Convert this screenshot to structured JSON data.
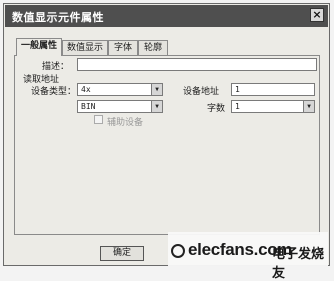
{
  "window": {
    "title": "数值显示元件属性",
    "close_glyph": "×"
  },
  "tabs": [
    {
      "label": "一般属性",
      "active": true
    },
    {
      "label": "数值显示",
      "active": false
    },
    {
      "label": "字体",
      "active": false
    },
    {
      "label": "轮廓",
      "active": false
    }
  ],
  "general": {
    "description_label": "描述：",
    "description_value": "",
    "read_address_label": "读取地址",
    "device_type_label": "设备类型：",
    "device_type_value": "4x",
    "device_address_label": "设备地址",
    "device_address_value": "1",
    "format_value": "BIN",
    "word_count_label": "字数",
    "word_count_value": "1",
    "aux_device_label": "辅助设备"
  },
  "buttons": {
    "ok_label": "确定"
  },
  "watermark": {
    "text": "elecfans.com",
    "subtext": "电子发烧友"
  }
}
